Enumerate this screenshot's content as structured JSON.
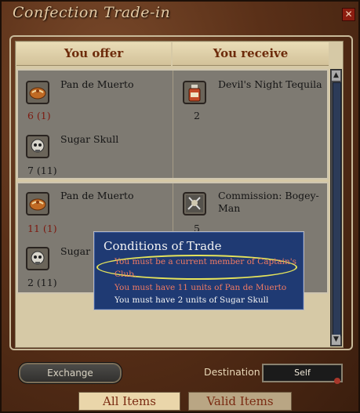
{
  "window": {
    "title": "Confection Trade-in",
    "close_label": "✕"
  },
  "columns": {
    "offer": "You offer",
    "receive": "You receive"
  },
  "trades": [
    {
      "offer": [
        {
          "name": "Pan de Muerto",
          "qty": "6 (1)",
          "icon": "pan-de-muerto-icon"
        },
        {
          "name": "Sugar Skull",
          "qty": "7 (11)",
          "icon": "sugar-skull-icon"
        }
      ],
      "receive": [
        {
          "name": "Devil's Night Tequila",
          "qty": "2",
          "icon": "tequila-icon"
        }
      ]
    },
    {
      "offer": [
        {
          "name": "Pan de Muerto",
          "qty": "11 (1)",
          "icon": "pan-de-muerto-icon"
        },
        {
          "name": "Sugar S",
          "qty": "2 (11)",
          "icon": "sugar-skull-icon"
        }
      ],
      "receive": [
        {
          "name": "Commission: Bogey-",
          "name2": "Man",
          "qty": "5",
          "icon": "commission-icon"
        }
      ]
    }
  ],
  "tooltip": {
    "title": "Conditions of Trade",
    "lines": [
      "You must be a current member of Captain's",
      "Club.",
      "You must have 11 units of Pan de Muerto",
      "You must have 2 units of Sugar Skull"
    ]
  },
  "footer": {
    "exchange_label": "Exchange",
    "destination_label": "Destination",
    "destination_value": "Self"
  },
  "tabs": {
    "all_items": "All Items",
    "valid_items": "Valid Items"
  },
  "colors": {
    "accent_red": "#7d1a10",
    "tooltip_bg": "#1f3a73",
    "panel": "#d6c9a6"
  }
}
